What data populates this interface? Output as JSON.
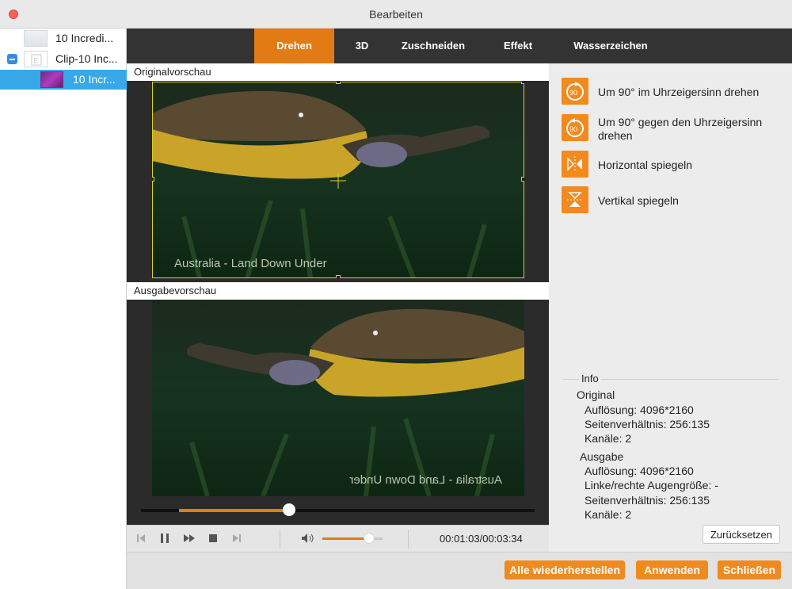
{
  "window": {
    "title": "Bearbeiten"
  },
  "clips": [
    {
      "label": "10 Incredi..."
    },
    {
      "label": "Clip-10 Inc..."
    },
    {
      "label": "10 Incr..."
    }
  ],
  "tabs": [
    {
      "label": "Drehen",
      "active": true
    },
    {
      "label": "3D"
    },
    {
      "label": "Zuschneiden"
    },
    {
      "label": "Effekt"
    },
    {
      "label": "Wasserzeichen"
    }
  ],
  "preview": {
    "original_label": "Originalvorschau",
    "output_label": "Ausgabevorschau",
    "caption": "Australia - Land Down Under",
    "progress": 0.28
  },
  "controls": {
    "time": "00:01:03/00:03:34",
    "volume": 0.78
  },
  "actions": [
    {
      "label": "Um 90° im Uhrzeigersinn drehen",
      "icon": "rotate-clockwise-icon"
    },
    {
      "label": "Um 90° gegen den Uhrzeigersinn drehen",
      "icon": "rotate-counterclockwise-icon"
    },
    {
      "label": "Horizontal spiegeln",
      "icon": "flip-horizontal-icon"
    },
    {
      "label": "Vertikal spiegeln",
      "icon": "flip-vertical-icon"
    }
  ],
  "info": {
    "title": "Info",
    "original": {
      "heading": "Original",
      "resolution": "Auflösung: 4096*2160",
      "aspect": "Seitenverhältnis: 256:135",
      "channels": "Kanäle: 2"
    },
    "output": {
      "heading": "Ausgabe",
      "resolution": "Auflösung: 4096*2160",
      "eye_size": "Linke/rechte Augengröße: -",
      "aspect": "Seitenverhältnis: 256:135",
      "channels": "Kanäle: 2"
    },
    "reset_label": "Zurücksetzen"
  },
  "footer": {
    "restore_all": "Alle wiederherstellen",
    "apply": "Anwenden",
    "close": "Schließen"
  },
  "colors": {
    "accent": "#e37b14",
    "tabbar": "#333333",
    "selection": "#38a8e8"
  }
}
